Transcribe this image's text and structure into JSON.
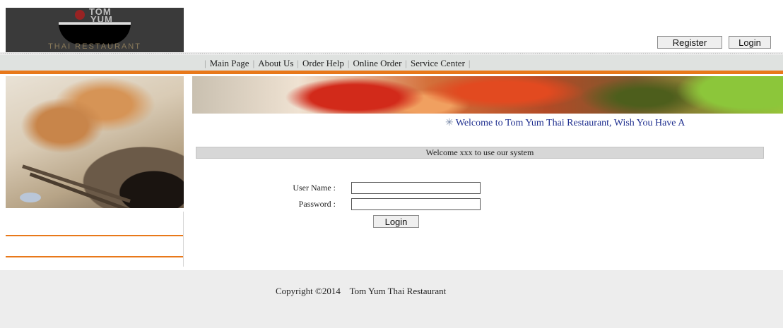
{
  "logo": {
    "line1": "TOM",
    "line2": "YUM",
    "subtitle": "THAI RESTAURANT"
  },
  "header": {
    "register_label": "Register",
    "login_label": "Login"
  },
  "nav": {
    "separator": "|",
    "items": [
      {
        "label": "Main Page"
      },
      {
        "label": "About Us"
      },
      {
        "label": "Order Help"
      },
      {
        "label": "Online Order"
      },
      {
        "label": "Service Center"
      }
    ]
  },
  "marquee": {
    "icon": "star-icon",
    "text": "Welcome to Tom Yum Thai Restaurant, Wish You Have A"
  },
  "welcome_bar": {
    "text": "Welcome xxx to use our system"
  },
  "login_form": {
    "username_label": "User Name :",
    "password_label": "Password :",
    "username_value": "",
    "password_value": "",
    "submit_label": "Login"
  },
  "footer": {
    "copyright": "Copyright ©2014    Tom Yum Thai Restaurant"
  },
  "colors": {
    "accent": "#e8781a",
    "nav_bg": "#dfe2e0",
    "marquee_text": "#1f2f8f",
    "footer_bg": "#ededed"
  }
}
